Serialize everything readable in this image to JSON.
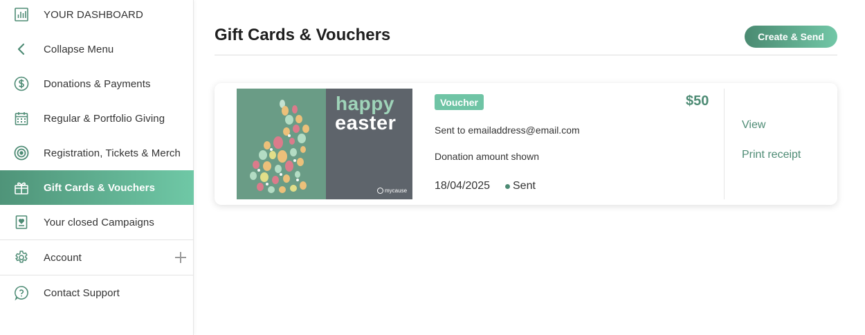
{
  "sidebar": {
    "items": [
      {
        "label": "YOUR DASHBOARD",
        "icon": "bar-chart-icon"
      },
      {
        "label": "Collapse Menu",
        "icon": "chevron-left-icon"
      },
      {
        "label": "Donations & Payments",
        "icon": "dollar-circle-icon"
      },
      {
        "label": "Regular & Portfolio Giving",
        "icon": "calendar-icon"
      },
      {
        "label": "Registration, Tickets & Merch",
        "icon": "target-icon"
      },
      {
        "label": "Gift Cards & Vouchers",
        "icon": "gift-icon"
      },
      {
        "label": "Your closed Campaigns",
        "icon": "campaign-heart-icon"
      },
      {
        "label": "Account",
        "icon": "gear-icon"
      },
      {
        "label": "Contact Support",
        "icon": "help-icon"
      }
    ],
    "active_item": "Gift Cards & Vouchers",
    "accent": "#5fb594"
  },
  "header": {
    "title": "Gift Cards & Vouchers",
    "create_button": "Create & Send"
  },
  "cards": [
    {
      "image": {
        "line1": "happy",
        "line2": "easter",
        "brand": "mycause"
      },
      "type_badge": "Voucher",
      "amount": "$50",
      "sent_to_label": "Sent to",
      "sent_to_email": "emailaddress@email.com",
      "donation_note": "Donation amount shown",
      "date": "18/04/2025",
      "status": "Sent",
      "actions": {
        "view": "View",
        "print": "Print receipt"
      }
    }
  ],
  "colors": {
    "brand_green": "#4d8b74",
    "badge_green": "#6fc4a5",
    "thumb_green": "#6a9c86",
    "thumb_gray": "#5e646b"
  }
}
